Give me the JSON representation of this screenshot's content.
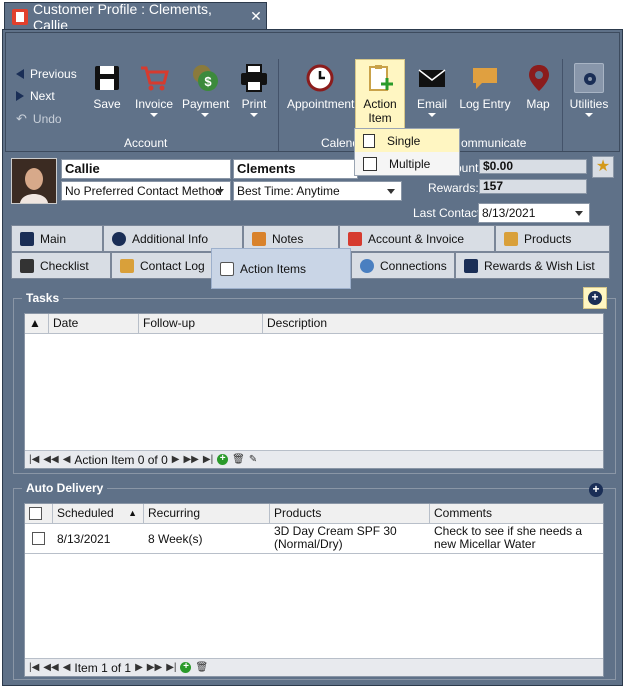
{
  "window": {
    "title": "Customer Profile : Clements, Callie",
    "close_glyph": "✕"
  },
  "ribbon": {
    "previous": "Previous",
    "next": "Next",
    "undo": "Undo",
    "save": "Save",
    "invoice": "Invoice",
    "payment": "Payment",
    "print": "Print",
    "appointment": "Appointment",
    "action_item_line1": "Action",
    "action_item_line2": "Item",
    "email": "Email",
    "log_entry": "Log Entry",
    "map": "Map",
    "utilities": "Utilities",
    "group_account": "Account",
    "group_calendar": "Calenda",
    "group_communicate": "ommunicate"
  },
  "action_menu": {
    "single": "Single",
    "multiple": "Multiple"
  },
  "customer": {
    "first_name": "Callie",
    "last_name": "Clements",
    "contact_method": "No Preferred Contact Method",
    "best_time": "Best Time: Anytime",
    "account_label": "ount:",
    "account_value": "$0.00",
    "rewards_label": "Rewards:",
    "rewards_value": "157",
    "last_contact_label": "Last Contact",
    "last_contact_value": "8/13/2021"
  },
  "tabs_row1": [
    "Main",
    "Additional Info",
    "Notes",
    "Account & Invoice",
    "Products"
  ],
  "tabs_row2": [
    "Checklist",
    "Contact Log",
    "Action Items",
    "Connections",
    "Rewards & Wish List"
  ],
  "tasks": {
    "title": "Tasks",
    "columns": [
      "Date",
      "Follow-up",
      "Description"
    ],
    "pager": "Action Item 0 of 0"
  },
  "auto_delivery": {
    "title": "Auto Delivery",
    "columns": [
      "Scheduled",
      "Recurring",
      "Products",
      "Comments"
    ],
    "rows": [
      {
        "scheduled": "8/13/2021",
        "recurring": "8 Week(s)",
        "products": "3D Day Cream SPF 30 (Normal/Dry)",
        "comments": "Check to see if she needs a new Micellar Water"
      }
    ],
    "pager": "Item 1 of 1"
  },
  "colors": {
    "frame": "#5f7188",
    "active_tab_highlight": "#c9d5e6",
    "dropdown_selected": "#fff6c2",
    "invoice_red": "#d63b2f",
    "payment_green": "#3c8a3c"
  }
}
